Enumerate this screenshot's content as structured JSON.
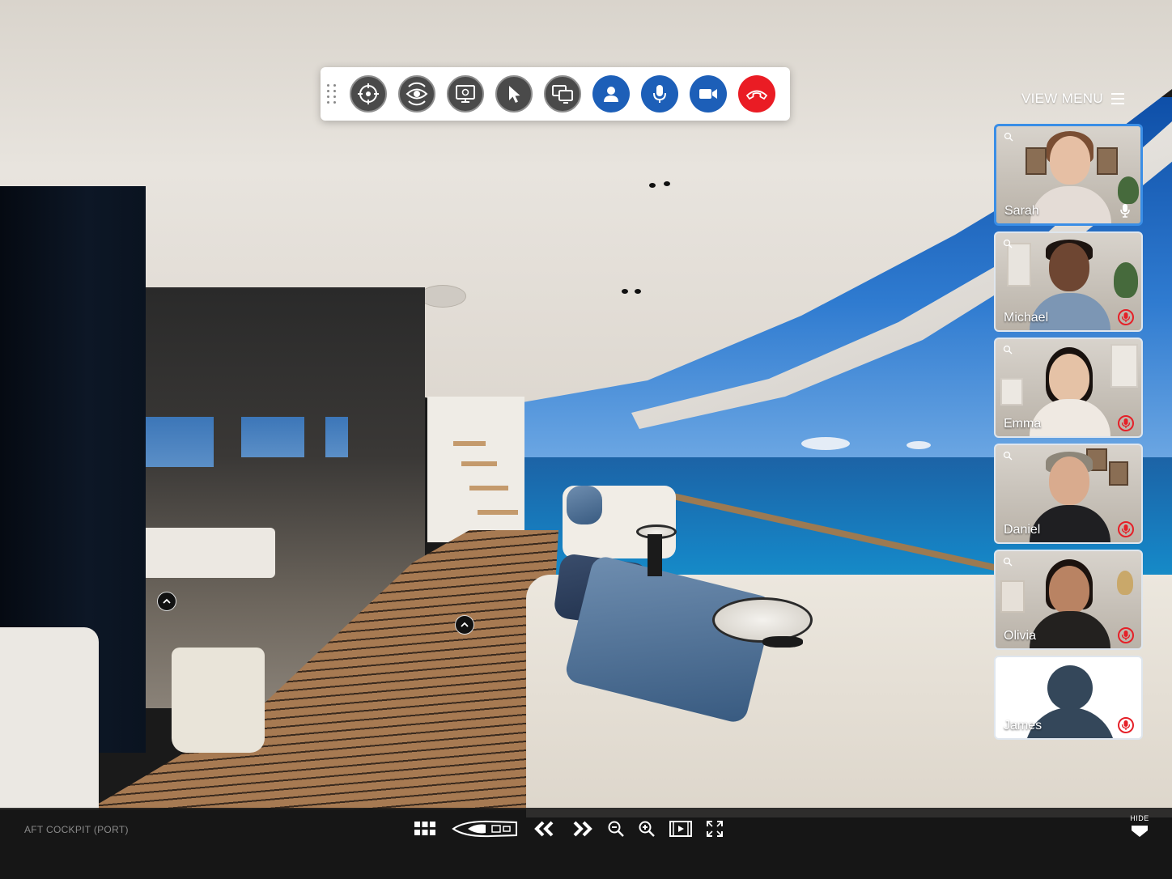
{
  "toolbar": {
    "buttons": [
      {
        "icon": "target-icon",
        "style": "gray"
      },
      {
        "icon": "eye-sync-icon",
        "style": "gray"
      },
      {
        "icon": "screen-view-icon",
        "style": "gray"
      },
      {
        "icon": "pointer-icon",
        "style": "gray"
      },
      {
        "icon": "screen-share-icon",
        "style": "gray"
      },
      {
        "icon": "user-icon",
        "style": "blue"
      },
      {
        "icon": "microphone-icon",
        "style": "blue"
      },
      {
        "icon": "video-camera-icon",
        "style": "blue"
      },
      {
        "icon": "hang-up-icon",
        "style": "red"
      }
    ]
  },
  "view_menu": {
    "label": "VIEW MENU"
  },
  "participants": [
    {
      "name": "Sarah",
      "mic": "on",
      "active": true
    },
    {
      "name": "Michael",
      "mic": "muted"
    },
    {
      "name": "Emma",
      "mic": "muted"
    },
    {
      "name": "Daniel",
      "mic": "muted"
    },
    {
      "name": "Olivia",
      "mic": "muted"
    },
    {
      "name": "James",
      "mic": "muted",
      "no_video": true
    }
  ],
  "bottom_bar": {
    "location": "AFT COCKPIT (PORT)",
    "controls": [
      "grid-icon",
      "yacht-plan-icon",
      "previous-icon",
      "next-icon",
      "zoom-out-icon",
      "zoom-in-icon",
      "slideshow-icon",
      "fullscreen-icon"
    ],
    "hide_label": "HIDE"
  },
  "colors": {
    "accent_blue": "#1d5fb8",
    "hangup_red": "#ea1c24",
    "active_tile_border": "#3a8ee6",
    "muted_red": "#e52028"
  }
}
